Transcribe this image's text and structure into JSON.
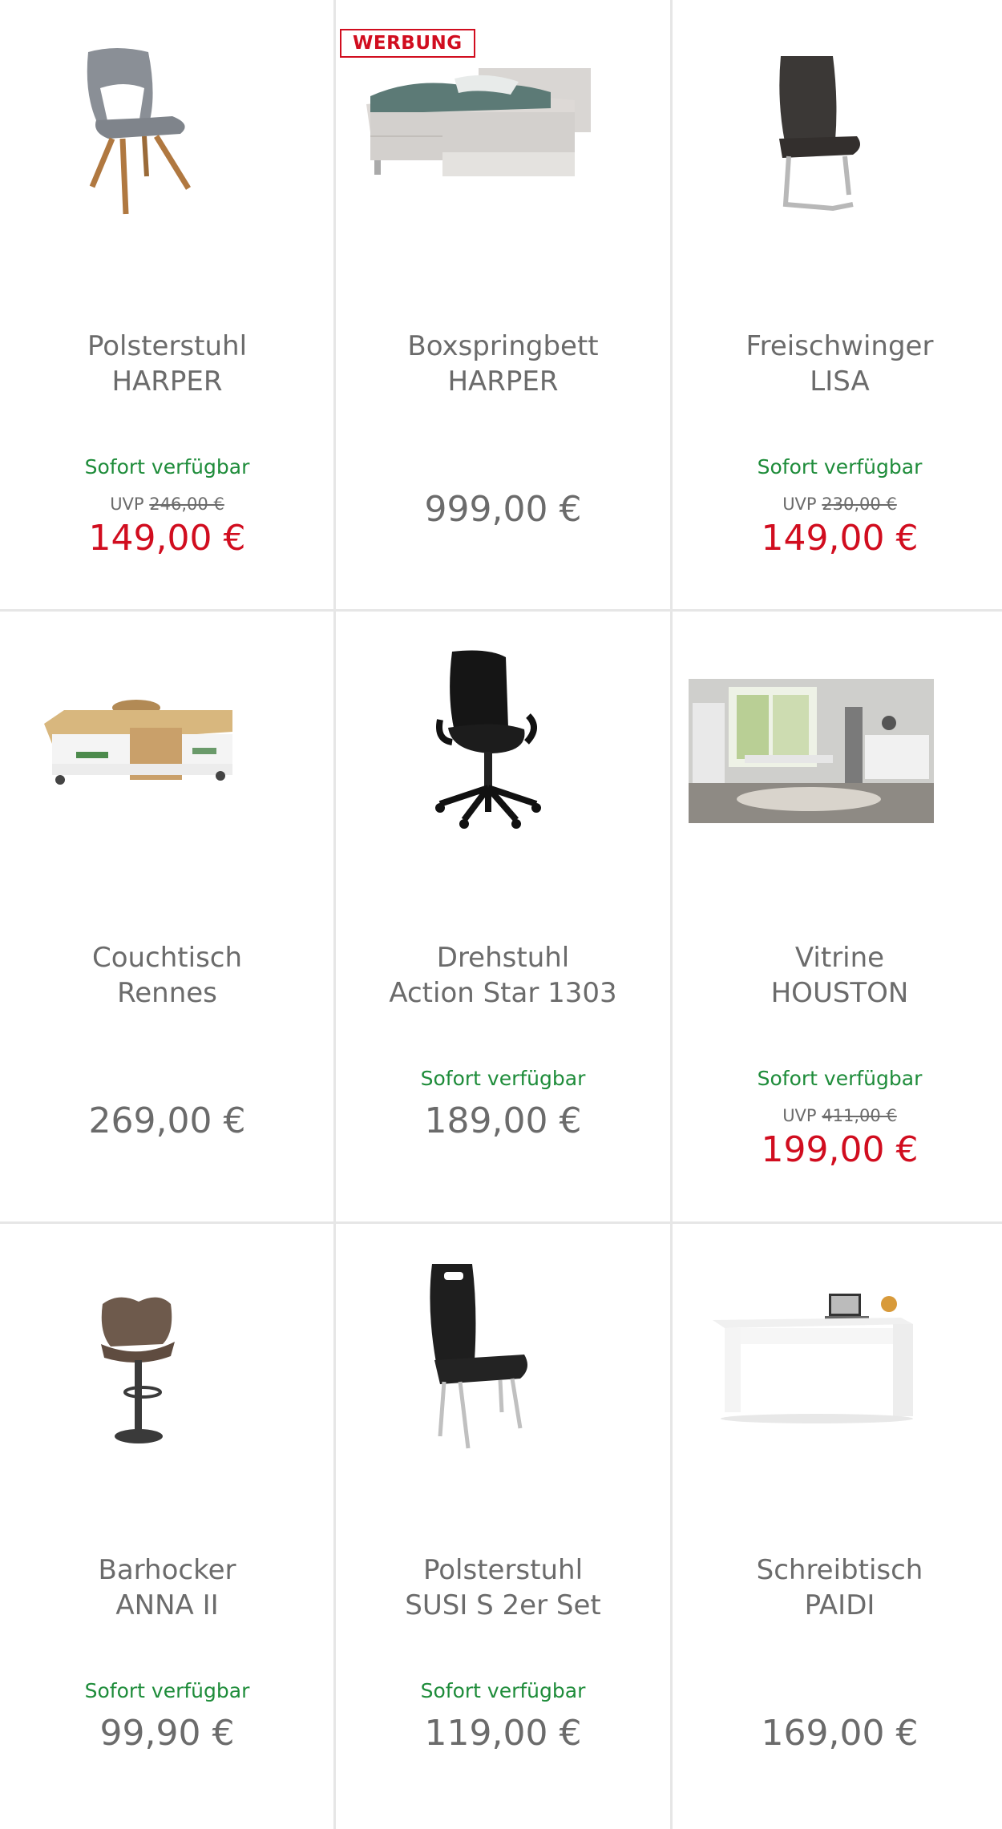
{
  "ad_badge": "WERBUNG",
  "products": [
    {
      "name_line1": "Polsterstuhl",
      "name_line2": "HARPER",
      "availability": "Sofort verfügbar",
      "uvp_label": "UVP",
      "uvp_price": "246,00 €",
      "price": "149,00 €",
      "image": "upholstered-chair-grey-icon"
    },
    {
      "name_line1": "Boxspringbett",
      "name_line2": "HARPER",
      "availability": "",
      "uvp_label": "",
      "uvp_price": "",
      "price": "999,00 €",
      "image": "boxspring-bed-icon",
      "sponsored": true
    },
    {
      "name_line1": "Freischwinger",
      "name_line2": "LISA",
      "availability": "Sofort verfügbar",
      "uvp_label": "UVP",
      "uvp_price": "230,00 €",
      "price": "149,00 €",
      "image": "cantilever-chair-icon"
    },
    {
      "name_line1": "Couchtisch",
      "name_line2": "Rennes",
      "availability": "",
      "uvp_label": "",
      "uvp_price": "",
      "price": "269,00 €",
      "image": "coffee-table-icon"
    },
    {
      "name_line1": "Drehstuhl",
      "name_line2": "Action Star 1303",
      "availability": "Sofort verfügbar",
      "uvp_label": "",
      "uvp_price": "",
      "price": "189,00 €",
      "image": "office-chair-icon"
    },
    {
      "name_line1": "Vitrine",
      "name_line2": "HOUSTON",
      "availability": "Sofort verfügbar",
      "uvp_label": "UVP",
      "uvp_price": "411,00 €",
      "price": "199,00 €",
      "image": "living-room-photo-icon"
    },
    {
      "name_line1": "Barhocker",
      "name_line2": "ANNA II",
      "availability": "Sofort verfügbar",
      "uvp_label": "",
      "uvp_price": "",
      "price": "99,90 €",
      "image": "bar-stool-icon"
    },
    {
      "name_line1": "Polsterstuhl",
      "name_line2": "SUSI S 2er Set",
      "availability": "Sofort verfügbar",
      "uvp_label": "",
      "uvp_price": "",
      "price": "119,00 €",
      "image": "black-chair-icon"
    },
    {
      "name_line1": "Schreibtisch",
      "name_line2": "PAIDI",
      "availability": "",
      "uvp_label": "",
      "uvp_price": "",
      "price": "169,00 €",
      "image": "desk-icon"
    }
  ],
  "colors": {
    "sale_price": "#d10d1f",
    "availability": "#1e8c3a",
    "text": "#6b6b6b",
    "divider": "#e6e6e6"
  }
}
